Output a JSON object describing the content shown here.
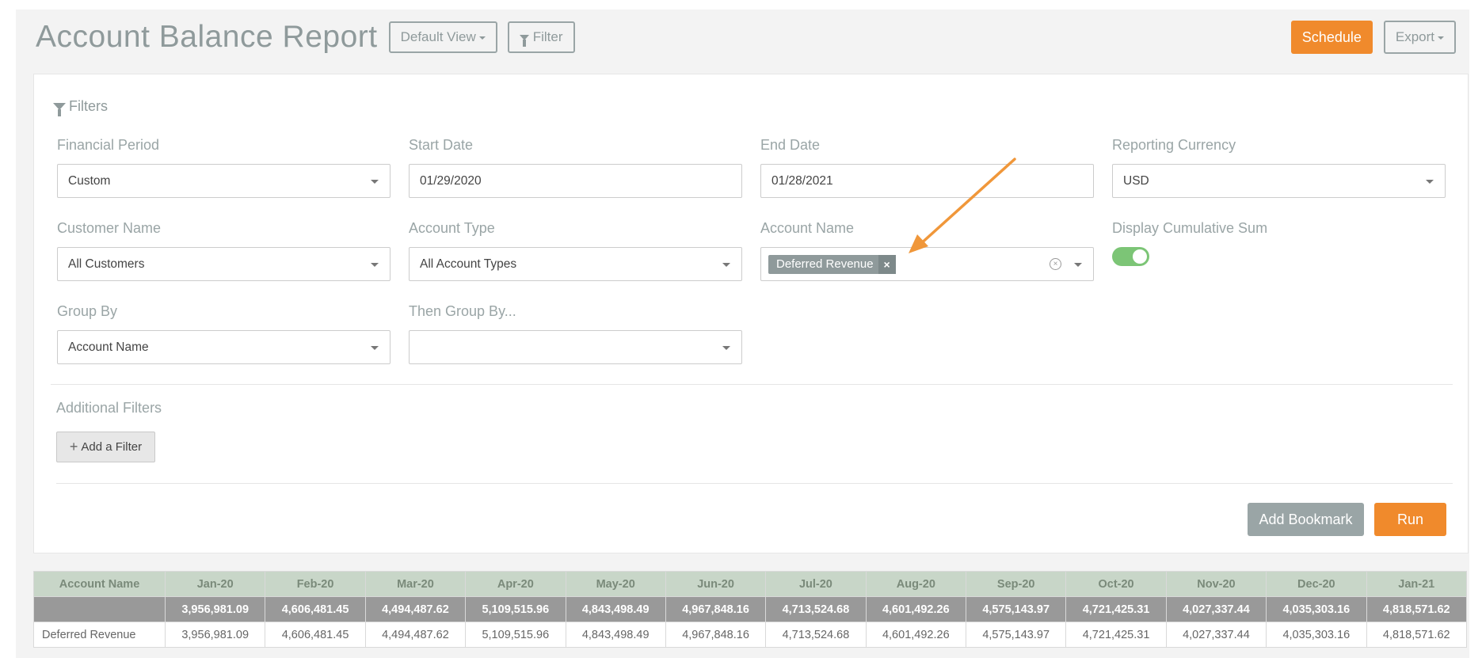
{
  "header": {
    "title": "Account Balance Report",
    "default_view_label": "Default View",
    "filter_label": "Filter",
    "schedule_label": "Schedule",
    "export_label": "Export"
  },
  "filters": {
    "section_title": "Filters",
    "financial_period": {
      "label": "Financial Period",
      "value": "Custom"
    },
    "start_date": {
      "label": "Start Date",
      "value": "01/29/2020"
    },
    "end_date": {
      "label": "End Date",
      "value": "01/28/2021"
    },
    "reporting_currency": {
      "label": "Reporting Currency",
      "value": "USD"
    },
    "customer_name": {
      "label": "Customer Name",
      "value": "All Customers"
    },
    "account_type": {
      "label": "Account Type",
      "value": "All Account Types"
    },
    "account_name": {
      "label": "Account Name",
      "tag": "Deferred Revenue",
      "tag_remove": "×"
    },
    "cumulative_sum": {
      "label": "Display Cumulative Sum",
      "enabled": true
    },
    "group_by": {
      "label": "Group By",
      "value": "Account Name"
    },
    "then_group_by": {
      "label": "Then Group By...",
      "value": ""
    },
    "additional_filters_label": "Additional Filters",
    "add_filter_label": "Add a Filter",
    "add_bookmark_label": "Add Bookmark",
    "run_label": "Run"
  },
  "colors": {
    "accent": "#f08a2c",
    "muted": "#8f9a9b",
    "toggle_on": "#7cc576",
    "table_header": "#c8d6c8"
  },
  "table": {
    "columns": [
      "Account Name",
      "Jan-20",
      "Feb-20",
      "Mar-20",
      "Apr-20",
      "May-20",
      "Jun-20",
      "Jul-20",
      "Aug-20",
      "Sep-20",
      "Oct-20",
      "Nov-20",
      "Dec-20",
      "Jan-21"
    ],
    "total": [
      "",
      "3,956,981.09",
      "4,606,481.45",
      "4,494,487.62",
      "5,109,515.96",
      "4,843,498.49",
      "4,967,848.16",
      "4,713,524.68",
      "4,601,492.26",
      "4,575,143.97",
      "4,721,425.31",
      "4,027,337.44",
      "4,035,303.16",
      "4,818,571.62"
    ],
    "rows": [
      [
        "Deferred Revenue",
        "3,956,981.09",
        "4,606,481.45",
        "4,494,487.62",
        "5,109,515.96",
        "4,843,498.49",
        "4,967,848.16",
        "4,713,524.68",
        "4,601,492.26",
        "4,575,143.97",
        "4,721,425.31",
        "4,027,337.44",
        "4,035,303.16",
        "4,818,571.62"
      ]
    ]
  }
}
